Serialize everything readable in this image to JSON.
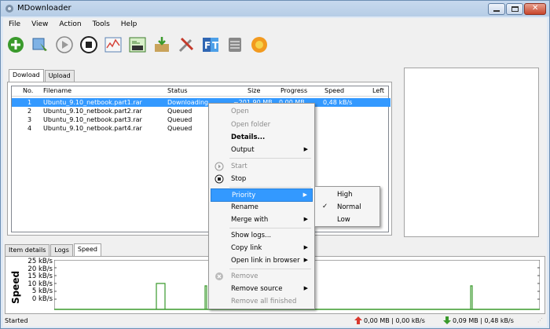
{
  "window": {
    "title": "MDownloader"
  },
  "menu": [
    "File",
    "View",
    "Action",
    "Tools",
    "Help"
  ],
  "toolbar": {
    "icons": [
      "add-download-icon",
      "add-batch-icon",
      "start-icon",
      "stop-icon",
      "speed-graph-icon",
      "code-icon",
      "queue-icon",
      "tools-icon",
      "ft-icon",
      "storage-icon",
      "firefox-icon"
    ]
  },
  "tabs": {
    "download": "Dowload",
    "upload": "Upload"
  },
  "columns": [
    "No.",
    "Filename",
    "Status",
    "Size",
    "Progress",
    "Speed",
    "Left"
  ],
  "rows": [
    {
      "no": "1",
      "filename": "Ubuntu_9.10_netbook.part1.rar",
      "status": "Downloading",
      "size": "~201,90 MB",
      "progress": "0,00 MB",
      "speed": "0,48 kB/s",
      "left": ""
    },
    {
      "no": "2",
      "filename": "Ubuntu_9.10_netbook.part2.rar",
      "status": "Queued",
      "size": "",
      "progress": "",
      "speed": "",
      "left": ""
    },
    {
      "no": "3",
      "filename": "Ubuntu_9.10_netbook.part3.rar",
      "status": "Queued",
      "size": "",
      "progress": "",
      "speed": "",
      "left": ""
    },
    {
      "no": "4",
      "filename": "Ubuntu_9.10_netbook.part4.rar",
      "status": "Queued",
      "size": "",
      "progress": "",
      "speed": "",
      "left": ""
    }
  ],
  "bottom_tabs": {
    "item_details": "Item details",
    "logs": "Logs",
    "speed": "Speed"
  },
  "speed_chart": {
    "ylabel": "Speed",
    "ticks": [
      "25 kB/s",
      "20 kB/s",
      "15 kB/s",
      "10 kB/s",
      "5 kB/s",
      "0 kB/s"
    ]
  },
  "status": {
    "text": "Started",
    "upload": "0,00 MB | 0,00 kB/s",
    "download": "0,09 MB | 0,48 kB/s"
  },
  "context_menu": {
    "open": "Open",
    "open_folder": "Open folder",
    "details": "Details...",
    "output": "Output",
    "start": "Start",
    "stop": "Stop",
    "priority": "Priority",
    "rename": "Rename",
    "merge_with": "Merge with",
    "show_logs": "Show logs...",
    "copy_link": "Copy link",
    "open_link_browser": "Open link in browser",
    "remove": "Remove",
    "remove_source": "Remove source",
    "remove_all_finished": "Remove all finished"
  },
  "priority_menu": {
    "high": "High",
    "normal": "Normal",
    "low": "Low",
    "selected": "Normal"
  },
  "colors": {
    "selection": "#3399ff",
    "accent_green": "#3a9a2c",
    "up_arrow": "#d9382e"
  }
}
